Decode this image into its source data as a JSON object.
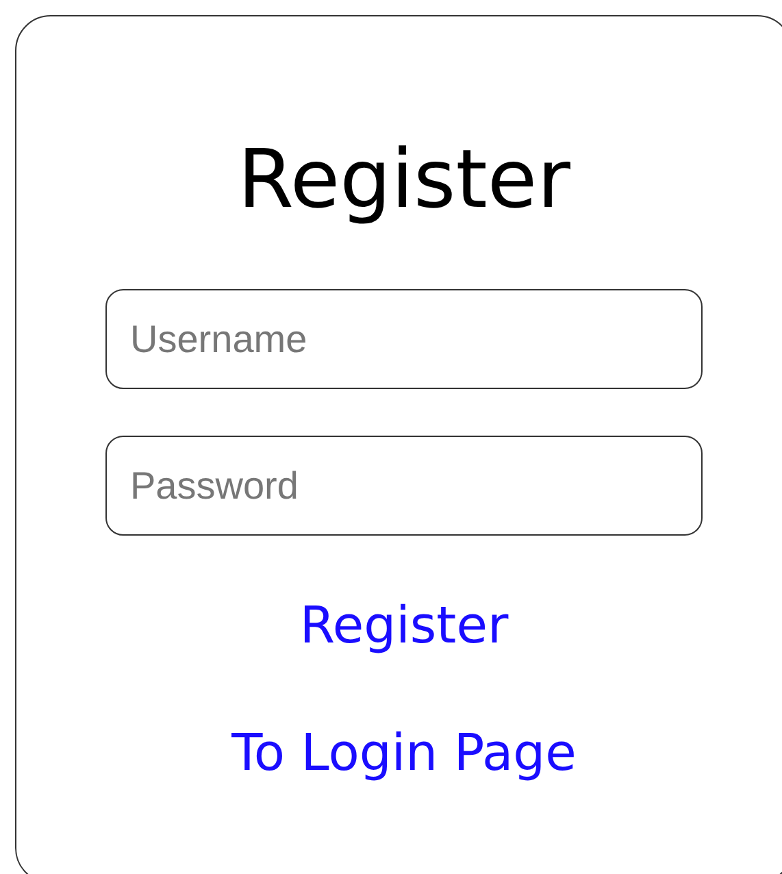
{
  "title": "Register",
  "fields": [
    {
      "placeholder": "Username"
    },
    {
      "placeholder": "Password"
    }
  ],
  "links": [
    "Register",
    "To Login Page"
  ]
}
